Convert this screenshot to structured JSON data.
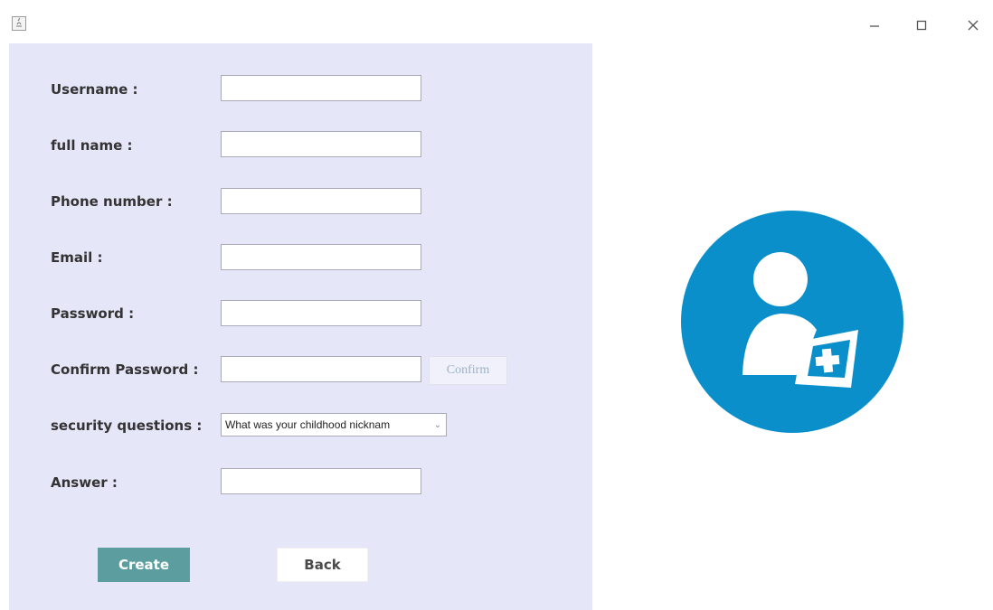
{
  "window": {
    "icon": "java-app-icon",
    "controls": [
      "minimize-icon",
      "maximize-icon",
      "close-icon"
    ]
  },
  "form": {
    "username": {
      "label": "Username :",
      "value": ""
    },
    "full_name": {
      "label": "full name :",
      "value": ""
    },
    "phone": {
      "label": "Phone number :",
      "value": ""
    },
    "email": {
      "label": "Email :",
      "value": ""
    },
    "password": {
      "label": "Password :",
      "value": ""
    },
    "confirm_password": {
      "label": "Confirm Password :",
      "value": "",
      "confirm_button": "Confirm"
    },
    "security_question": {
      "label": "security questions :",
      "selected": "What was your childhood nicknam"
    },
    "answer": {
      "label": "Answer :",
      "value": ""
    },
    "create_button": "Create",
    "back_button": "Back"
  },
  "illustration": {
    "icon": "add-user-icon"
  },
  "colors": {
    "panel_bg": "#e6e6f9",
    "create_button_bg": "#5c9ea0",
    "avatar_circle": "#0a8fca"
  }
}
